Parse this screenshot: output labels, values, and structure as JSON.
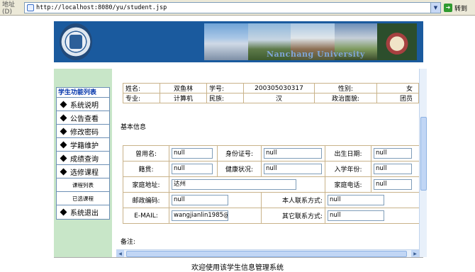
{
  "browser": {
    "address_label": "地址(D)",
    "url": "http://localhost:8080/yu/student.jsp",
    "go_label": "转到"
  },
  "banner": {
    "caption": "Nanchang University"
  },
  "sidebar": {
    "title": "学生功能列表",
    "items": [
      {
        "label": "系统说明"
      },
      {
        "label": "公告查看"
      },
      {
        "label": "修改密码"
      },
      {
        "label": "学籍维护"
      },
      {
        "label": "成绩查询"
      },
      {
        "label": "选修课程"
      }
    ],
    "subitems": [
      {
        "label": "课程列表"
      },
      {
        "label": "已选课程"
      }
    ],
    "exit_label": "系统退出"
  },
  "student": {
    "name_label": "姓名:",
    "name": "双鱼林",
    "id_label": "学号:",
    "id": "200305030317",
    "gender_label": "性别:",
    "gender": "女",
    "major_label": "专业:",
    "major": "计算机",
    "ethnicity_label": "民族:",
    "ethnicity": "汉",
    "politics_label": "政治面貌:",
    "politics": "团员"
  },
  "basic": {
    "section_title": "基本信息",
    "alias_label": "曾用名:",
    "alias": "null",
    "idcard_label": "身份证号:",
    "idcard": "null",
    "birth_label": "出生日期:",
    "birth": "null",
    "native_label": "籍贯:",
    "native": "null",
    "health_label": "健康状况:",
    "health": "null",
    "enroll_label": "入学年份:",
    "enroll": "null",
    "address_label": "家庭地址:",
    "address": "达州",
    "homephone_label": "家庭电话:",
    "homephone": "null",
    "zip_label": "邮政编码:",
    "zip": "null",
    "contact_label": "本人联系方式:",
    "contact": "null",
    "email_label": "E-MAIL:",
    "email": "wangjianlin1985@",
    "other_label": "其它联系方式:",
    "other": "null",
    "remark_label": "备注:"
  },
  "footer": {
    "text": "欢迎使用该学生信息管理系统"
  },
  "colors": {
    "banner": "#1a5a9e",
    "sidebar_bg": "#c8e6c8",
    "menu_title": "#0033aa",
    "table_border": "#c9b38a"
  }
}
